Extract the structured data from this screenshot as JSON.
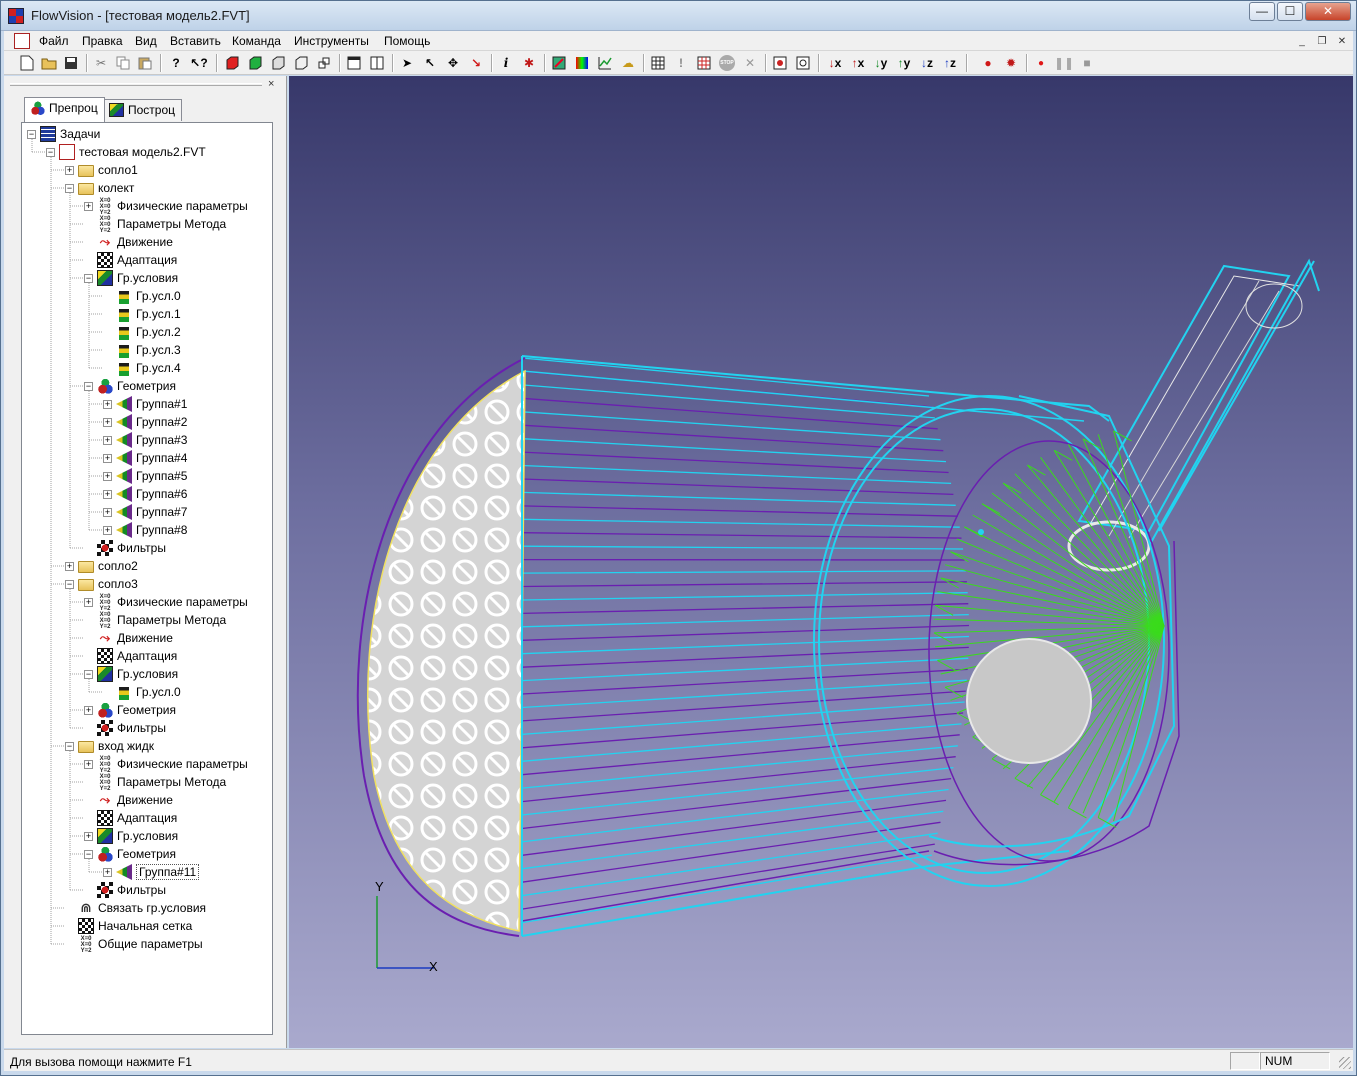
{
  "window": {
    "title": "FlowVision - [тестовая модель2.FVT]"
  },
  "caption_buttons": {
    "minimize": "—",
    "maximize": "☐",
    "close": "✕"
  },
  "menu": {
    "items": [
      {
        "label": "Файл"
      },
      {
        "label": "Правка"
      },
      {
        "label": "Вид"
      },
      {
        "label": "Вставить"
      },
      {
        "label": "Команда"
      },
      {
        "label": "Инструменты"
      },
      {
        "label": "Помощь"
      }
    ],
    "mdi": {
      "minimize": "_",
      "restore": "❐",
      "close": "✕"
    }
  },
  "toolbar": {
    "tools": [
      "new-file-icon",
      "open-folder-icon",
      "save-icon",
      "cut-icon",
      "copy-icon",
      "paste-icon",
      "help-icon",
      "context-help-icon",
      "red-cube-icon",
      "green-cube-icon",
      "cube-icon",
      "cube-outline-icon",
      "cubes-icon",
      "window-icon",
      "window-split-icon",
      "select-arrow-icon",
      "pointer-icon",
      "move-axes-icon",
      "red-arrow-icon",
      "info-icon",
      "debug-icon",
      "brush-icon",
      "palette-icon",
      "graph-icon",
      "cloud-icon",
      "grid-icon",
      "exclaim-icon",
      "stop-grid-icon",
      "stop-icon",
      "cross-icon",
      "view-icon",
      "view-fit-icon",
      "view-x-down",
      "view-x-up",
      "view-y-down",
      "view-y-up",
      "view-z-down",
      "view-z-up",
      "record-setup-icon",
      "bug-icon",
      "record-icon",
      "pause-icon",
      "stop-square-icon"
    ],
    "axis_labels": [
      "x",
      "x",
      "y",
      "y",
      "z",
      "z"
    ],
    "info_glyph": "i",
    "exclaim_glyph": "!",
    "help_glyph": "?",
    "stop_label": "STOP"
  },
  "left_pane": {
    "close_glyph": "×",
    "tabs": [
      {
        "label": "Препроц",
        "active": true
      },
      {
        "label": "Построц",
        "active": false
      }
    ]
  },
  "tree": {
    "nodes": [
      {
        "label": "Задачи",
        "level": 0,
        "expander": "minus",
        "icon": "grid-icon"
      },
      {
        "label": "тестовая модель2.FVT",
        "level": 1,
        "expander": "minus",
        "icon": "file-icon"
      },
      {
        "label": "сопло1",
        "level": 2,
        "expander": "plus",
        "icon": "folder-icon"
      },
      {
        "label": "колект",
        "level": 2,
        "expander": "minus",
        "icon": "folder-icon"
      },
      {
        "label": "Физические параметры",
        "level": 3,
        "expander": "plus",
        "icon": "phys-params-icon"
      },
      {
        "label": "Параметры Метода",
        "level": 3,
        "expander": "none",
        "icon": "phys-params-icon"
      },
      {
        "label": "Движение",
        "level": 3,
        "expander": "none",
        "icon": "motion-icon"
      },
      {
        "label": "Адаптация",
        "level": 3,
        "expander": "none",
        "icon": "adapt-icon"
      },
      {
        "label": "Гр.условия",
        "level": 3,
        "expander": "minus",
        "icon": "bc-icon"
      },
      {
        "label": "Гр.усл.0",
        "level": 4,
        "expander": "none",
        "icon": "bc-item-icon"
      },
      {
        "label": "Гр.усл.1",
        "level": 4,
        "expander": "none",
        "icon": "bc-item-icon"
      },
      {
        "label": "Гр.усл.2",
        "level": 4,
        "expander": "none",
        "icon": "bc-item-icon"
      },
      {
        "label": "Гр.усл.3",
        "level": 4,
        "expander": "none",
        "icon": "bc-item-icon"
      },
      {
        "label": "Гр.усл.4",
        "level": 4,
        "expander": "none",
        "icon": "bc-item-icon"
      },
      {
        "label": "Геометрия",
        "level": 3,
        "expander": "minus",
        "icon": "geometry-icon"
      },
      {
        "label": "Группа#1",
        "level": 4,
        "expander": "plus",
        "icon": "group-icon"
      },
      {
        "label": "Группа#2",
        "level": 4,
        "expander": "plus",
        "icon": "group-icon"
      },
      {
        "label": "Группа#3",
        "level": 4,
        "expander": "plus",
        "icon": "group-icon"
      },
      {
        "label": "Группа#4",
        "level": 4,
        "expander": "plus",
        "icon": "group-icon"
      },
      {
        "label": "Группа#5",
        "level": 4,
        "expander": "plus",
        "icon": "group-icon"
      },
      {
        "label": "Группа#6",
        "level": 4,
        "expander": "plus",
        "icon": "group-icon"
      },
      {
        "label": "Группа#7",
        "level": 4,
        "expander": "plus",
        "icon": "group-icon"
      },
      {
        "label": "Группа#8",
        "level": 4,
        "expander": "plus",
        "icon": "group-icon"
      },
      {
        "label": "Фильтры",
        "level": 3,
        "expander": "none",
        "icon": "filter-icon"
      },
      {
        "label": "сопло2",
        "level": 2,
        "expander": "plus",
        "icon": "folder-icon"
      },
      {
        "label": "сопло3",
        "level": 2,
        "expander": "minus",
        "icon": "folder-icon"
      },
      {
        "label": "Физические параметры",
        "level": 3,
        "expander": "plus",
        "icon": "phys-params-icon"
      },
      {
        "label": "Параметры Метода",
        "level": 3,
        "expander": "none",
        "icon": "phys-params-icon"
      },
      {
        "label": "Движение",
        "level": 3,
        "expander": "none",
        "icon": "motion-icon"
      },
      {
        "label": "Адаптация",
        "level": 3,
        "expander": "none",
        "icon": "adapt-icon"
      },
      {
        "label": "Гр.условия",
        "level": 3,
        "expander": "minus",
        "icon": "bc-icon"
      },
      {
        "label": "Гр.усл.0",
        "level": 4,
        "expander": "none",
        "icon": "bc-item-icon"
      },
      {
        "label": "Геометрия",
        "level": 3,
        "expander": "plus",
        "icon": "geometry-icon"
      },
      {
        "label": "Фильтры",
        "level": 3,
        "expander": "none",
        "icon": "filter-icon"
      },
      {
        "label": "вход жидк",
        "level": 2,
        "expander": "minus",
        "icon": "folder-icon"
      },
      {
        "label": "Физические параметры",
        "level": 3,
        "expander": "plus",
        "icon": "phys-params-icon"
      },
      {
        "label": "Параметры Метода",
        "level": 3,
        "expander": "none",
        "icon": "phys-params-icon"
      },
      {
        "label": "Движение",
        "level": 3,
        "expander": "none",
        "icon": "motion-icon"
      },
      {
        "label": "Адаптация",
        "level": 3,
        "expander": "none",
        "icon": "adapt-icon"
      },
      {
        "label": "Гр.условия",
        "level": 3,
        "expander": "plus",
        "icon": "bc-icon"
      },
      {
        "label": "Геометрия",
        "level": 3,
        "expander": "minus",
        "icon": "geometry-icon"
      },
      {
        "label": "Группа#11",
        "level": 4,
        "expander": "plus",
        "icon": "group-icon",
        "selected": true
      },
      {
        "label": "Фильтры",
        "level": 3,
        "expander": "none",
        "icon": "filter-icon"
      },
      {
        "label": "Связать гр.условия",
        "level": 2,
        "expander": "none",
        "icon": "link-icon"
      },
      {
        "label": "Начальная сетка",
        "level": 2,
        "expander": "none",
        "icon": "adapt-icon"
      },
      {
        "label": "Общие параметры",
        "level": 2,
        "expander": "none",
        "icon": "phys-params-icon"
      }
    ]
  },
  "viewport": {
    "axis_y_label": "Y",
    "axis_x_label": "X",
    "colors": {
      "background_top": "#37386a",
      "background_bottom": "#a9a9cd",
      "cyan_edges": "#22d3f0",
      "purple_edges": "#6a1fb0",
      "green_mesh": "#3adb1c",
      "inlet_face": "#d6d6d6"
    }
  },
  "statusbar": {
    "help_text": "Для вызова помощи нажмите F1",
    "num_indicator": "NUM"
  }
}
